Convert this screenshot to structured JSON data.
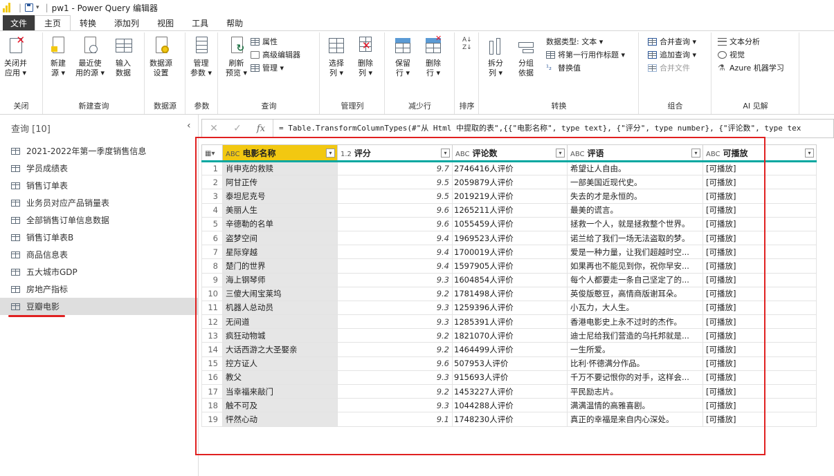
{
  "titlebar": {
    "title": "pw1 - Power Query 编辑器"
  },
  "menu": {
    "tabs": [
      "文件",
      "主页",
      "转换",
      "添加列",
      "视图",
      "工具",
      "帮助"
    ],
    "active": "主页"
  },
  "ribbon": {
    "close_apply": [
      "关闭并",
      "应用 ▾"
    ],
    "new_source": [
      "新建",
      "源 ▾"
    ],
    "recent_sources": [
      "最近使",
      "用的源 ▾"
    ],
    "enter_data": [
      "输入",
      "数据"
    ],
    "data_source_settings": [
      "数据源",
      "设置"
    ],
    "manage_params": [
      "管理",
      "参数 ▾"
    ],
    "refresh_preview": [
      "刷新",
      "预览 ▾"
    ],
    "properties": "属性",
    "advanced_editor": "高级编辑器",
    "manage": "管理 ▾",
    "choose_cols": [
      "选择",
      "列 ▾"
    ],
    "remove_cols": [
      "删除",
      "列 ▾"
    ],
    "keep_rows": [
      "保留",
      "行 ▾"
    ],
    "remove_rows": [
      "删除",
      "行 ▾"
    ],
    "split_col": [
      "拆分",
      "列 ▾"
    ],
    "group_by": [
      "分组",
      "依据"
    ],
    "data_type": "数据类型: 文本 ▾",
    "use_first_row": "将第一行用作标题 ▾",
    "replace_values": "替换值",
    "merge_queries": "合并查询 ▾",
    "append_queries": "追加查询 ▾",
    "combine_files": "合并文件",
    "text_analytics": "文本分析",
    "vision": "视觉",
    "azure_ml": "Azure 机器学习",
    "groups": {
      "close": "关闭",
      "new_query": "新建查询",
      "data_sources": "数据源",
      "params": "参数",
      "query": "查询",
      "manage_cols": "管理列",
      "reduce_rows": "减少行",
      "sort": "排序",
      "transform": "转换",
      "combine": "组合",
      "ai": "AI 见解"
    }
  },
  "queries": {
    "header": "查询 [10]",
    "items": [
      "2021-2022年第一季度销售信息",
      "学员成绩表",
      "销售订单表",
      "业务员对应产品销量表",
      "全部销售订单信息数据",
      "销售订单表B",
      "商品信息表",
      "五大城市GDP",
      "房地产指标",
      "豆瓣电影"
    ],
    "selected_index": 9
  },
  "formula": {
    "prefix": "= Table.TransformColumnTypes(#\"从 Html 中提取的表\",{{\"电影名称\", type text}, {\"评分\", type number}, {\"评论数\", type tex"
  },
  "table": {
    "columns": [
      {
        "type": "ABC",
        "name": "电影名称"
      },
      {
        "type": "1.2",
        "name": "评分"
      },
      {
        "type": "ABC",
        "name": "评论数"
      },
      {
        "type": "ABC",
        "name": "评语"
      },
      {
        "type": "ABC",
        "name": "可播放"
      }
    ],
    "rows": [
      [
        "1",
        "肖申克的救赎",
        "9.7",
        "2746416人评价",
        "希望让人自由。",
        "[可播放]"
      ],
      [
        "2",
        "阿甘正传",
        "9.5",
        "2059879人评价",
        "一部美国近现代史。",
        "[可播放]"
      ],
      [
        "3",
        "泰坦尼克号",
        "9.5",
        "2019219人评价",
        "失去的才是永恒的。",
        "[可播放]"
      ],
      [
        "4",
        "美丽人生",
        "9.6",
        "1265211人评价",
        "最美的谎言。",
        "[可播放]"
      ],
      [
        "5",
        "辛德勒的名单",
        "9.6",
        "1055459人评价",
        "拯救一个人，就是拯救整个世界。",
        "[可播放]"
      ],
      [
        "6",
        "盗梦空间",
        "9.4",
        "1969523人评价",
        "诺兰给了我们一场无法盗取的梦。",
        "[可播放]"
      ],
      [
        "7",
        "星际穿越",
        "9.4",
        "1700019人评价",
        "爱是一种力量，让我们超越时空...",
        "[可播放]"
      ],
      [
        "8",
        "楚门的世界",
        "9.4",
        "1597905人评价",
        "如果再也不能见到你，祝你早安...",
        "[可播放]"
      ],
      [
        "9",
        "海上钢琴师",
        "9.3",
        "1604854人评价",
        "每个人都要走一条自己坚定了的...",
        "[可播放]"
      ],
      [
        "10",
        "三傻大闹宝莱坞",
        "9.2",
        "1781498人评价",
        "英俊版憨豆，高情商版谢耳朵。",
        "[可播放]"
      ],
      [
        "11",
        "机器人总动员",
        "9.3",
        "1259396人评价",
        "小瓦力，大人生。",
        "[可播放]"
      ],
      [
        "12",
        "无间道",
        "9.3",
        "1285391人评价",
        "香港电影史上永不过时的杰作。",
        "[可播放]"
      ],
      [
        "13",
        "疯狂动物城",
        "9.2",
        "1821070人评价",
        "迪士尼给我们营造的乌托邦就是...",
        "[可播放]"
      ],
      [
        "14",
        "大话西游之大圣娶亲",
        "9.2",
        "1464499人评价",
        "一生所爱。",
        "[可播放]"
      ],
      [
        "15",
        "控方证人",
        "9.6",
        "507953人评价",
        "比利·怀德满分作品。",
        "[可播放]"
      ],
      [
        "16",
        "教父",
        "9.3",
        "915693人评价",
        "千万不要记恨你的对手，这样会...",
        "[可播放]"
      ],
      [
        "17",
        "当幸福来敲门",
        "9.2",
        "1453227人评价",
        "平民励志片。",
        "[可播放]"
      ],
      [
        "18",
        "触不可及",
        "9.3",
        "1044288人评价",
        "满满温情的高雅喜剧。",
        "[可播放]"
      ],
      [
        "19",
        "怦然心动",
        "9.1",
        "1748230人评价",
        "真正的幸福是来自内心深处。",
        "[可播放]"
      ]
    ]
  },
  "colors": {
    "accent": "#f2c811",
    "highlight": "#e02020",
    "teal": "#00a7a0"
  }
}
